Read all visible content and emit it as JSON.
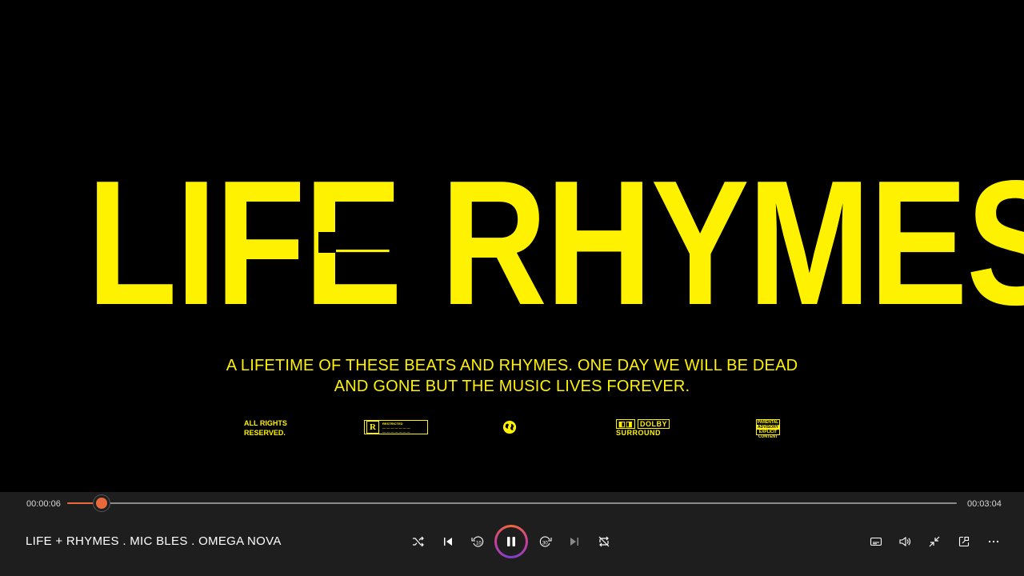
{
  "video": {
    "title": "LIFE RHYMES",
    "subtitle_line1": "A LIFETIME OF THESE BEATS AND RHYMES. ONE DAY WE WILL BE DEAD",
    "subtitle_line2": "AND GONE BUT THE MUSIC LIVES FOREVER.",
    "rights_line1": "ALL RIGHTS",
    "rights_line2": "RESERVED.",
    "restricted_label": "RESTRICTED",
    "dolby_label": "DOLBY",
    "dolby_sub": "SURROUND",
    "advisory_top": "PARENTAL",
    "advisory_mid": "ADVISORY",
    "advisory_bottom": "EXPLICIT CONTENT",
    "accent_color": "#fff200"
  },
  "player": {
    "time_elapsed": "00:00:06",
    "time_total": "00:03:04",
    "progress_fraction": 0.039,
    "now_playing": "LIFE + RHYMES . MIC BLES . OMEGA NOVA",
    "skip_back_seconds": "10",
    "skip_forward_seconds": "30",
    "accent_color": "#e86a3a",
    "controls": [
      "shuffle-icon",
      "previous-icon",
      "skip-back-10-icon",
      "pause-icon",
      "skip-forward-30-icon",
      "next-icon",
      "repeat-icon"
    ],
    "right_controls": [
      "captions-icon",
      "volume-icon",
      "collapse-icon",
      "mini-player-icon",
      "more-icon"
    ]
  }
}
